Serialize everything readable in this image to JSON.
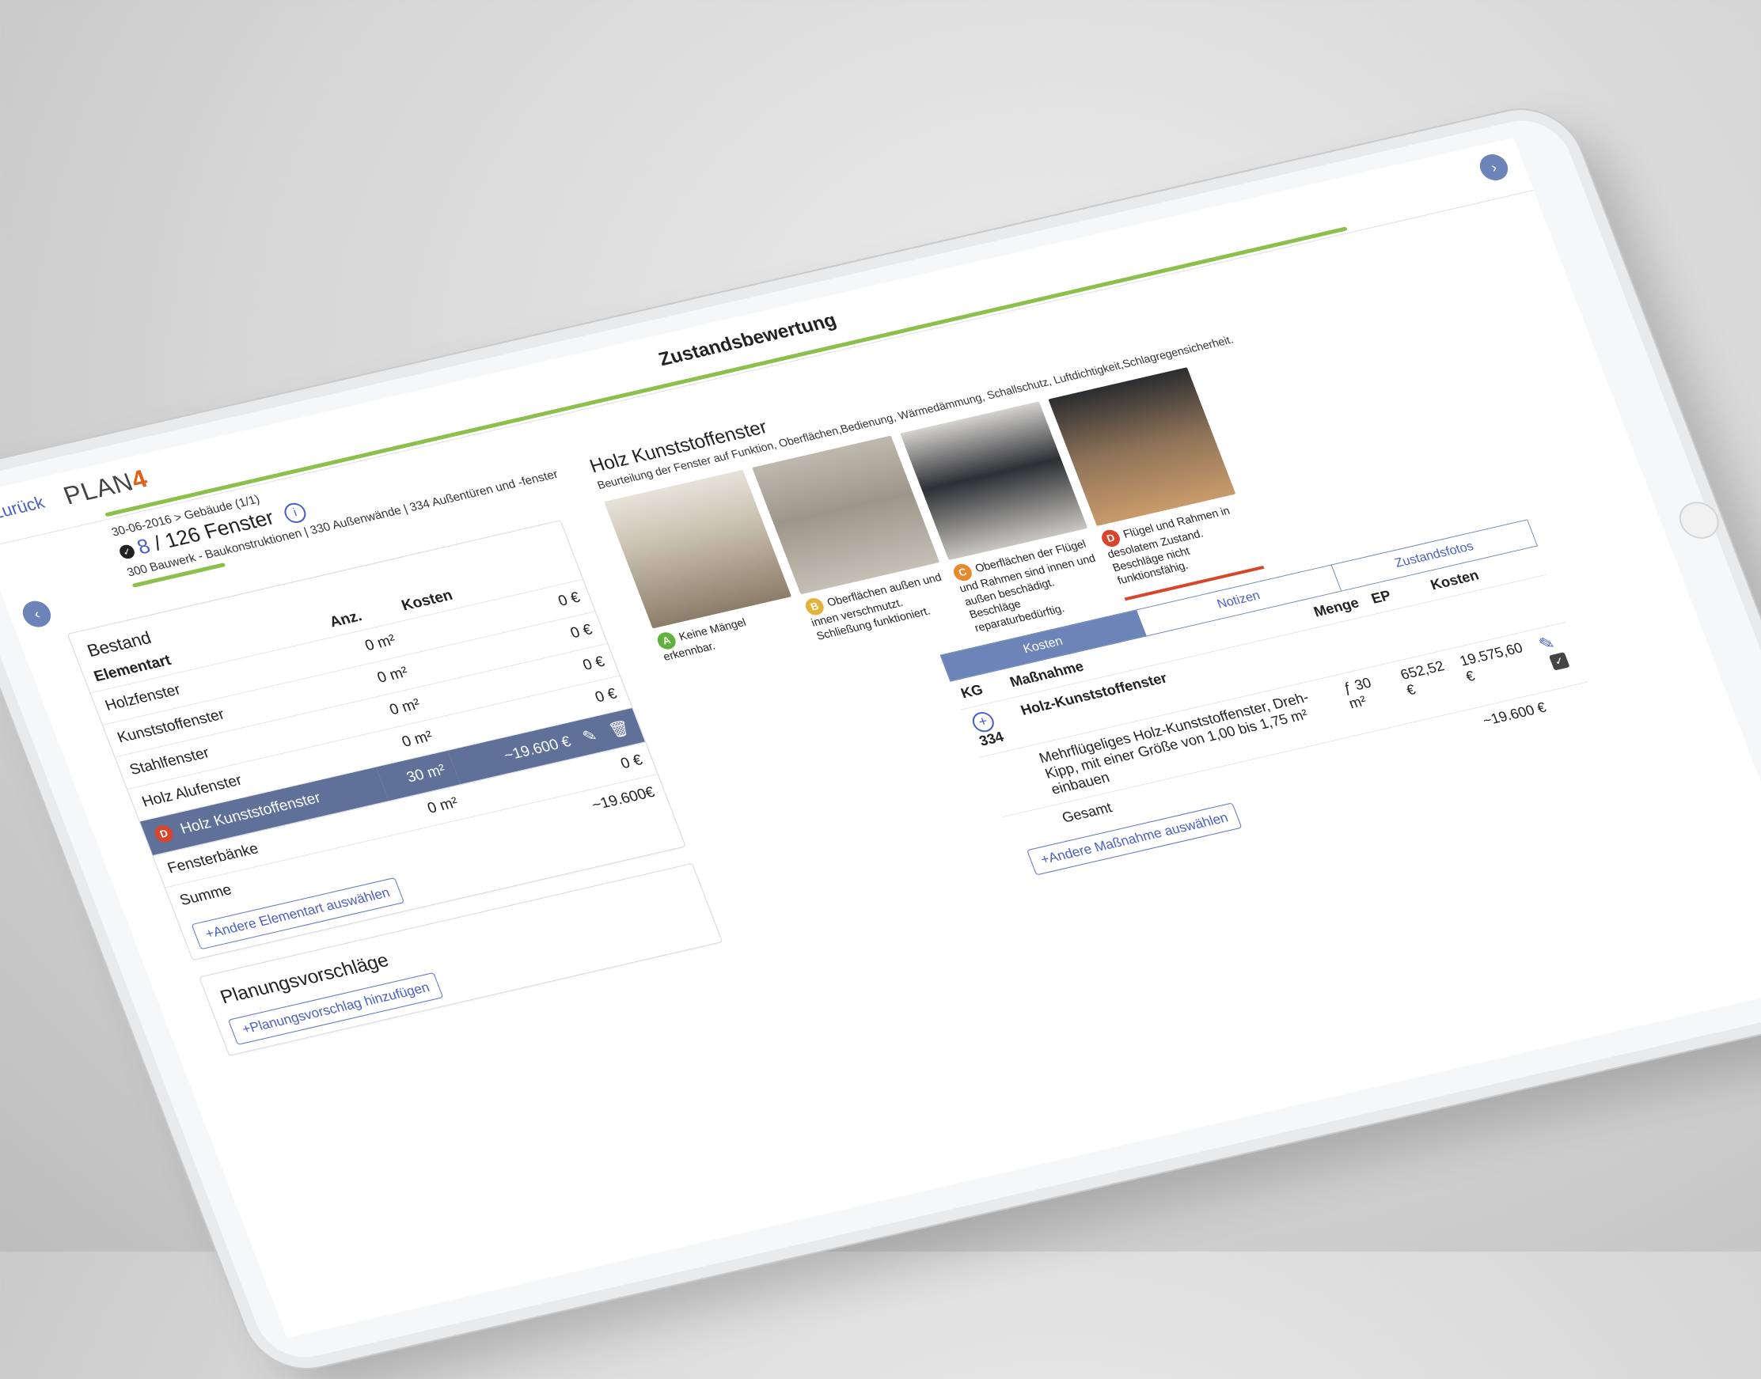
{
  "app": {
    "back_label": "Zurück",
    "logo_text": "PLAN",
    "logo_accent": "4",
    "title": "Zustandsbewertung"
  },
  "header": {
    "date_path": "30-06-2016 > Gebäude (1/1)",
    "current": "8",
    "total_text": "/ 126 Fenster",
    "breadcrumb": "300 Bauwerk - Baukonstruktionen | 330 Außenwände | 334 Außentüren und -fenster"
  },
  "bestand": {
    "title": "Bestand",
    "columns": [
      "Elementart",
      "Anz.",
      "Kosten"
    ],
    "rows": [
      {
        "name": "Holzfenster",
        "anz": "0 m²",
        "kosten": "0 €"
      },
      {
        "name": "Kunststoffenster",
        "anz": "0 m²",
        "kosten": "0 €"
      },
      {
        "name": "Stahlfenster",
        "anz": "0 m²",
        "kosten": "0 €"
      },
      {
        "name": "Holz Alufenster",
        "anz": "0 m²",
        "kosten": "0 €"
      },
      {
        "name": "Holz Kunststoffenster",
        "anz": "30 m²",
        "kosten": "~19.600 €",
        "badge": "D"
      },
      {
        "name": "Fensterbänke",
        "anz": "0 m²",
        "kosten": "0 €"
      }
    ],
    "summe_label": "Summe",
    "summe_value": "~19.600€",
    "add_button": "+Andere Elementart auswählen"
  },
  "planung": {
    "title": "Planungsvorschläge",
    "add_button": "+Planungsvorschlag hinzufügen"
  },
  "detail": {
    "title": "Holz Kunststoffenster",
    "description": "Beurteilung der Fenster auf Funktion, Oberflächen,Bedienung, Wärmedämmung, Schallschutz, Luftdichtigkeit,Schlagregensicherheit.",
    "photos": [
      {
        "badge": "A",
        "caption": "Keine Mängel erkennbar."
      },
      {
        "badge": "B",
        "caption": "Oberflächen außen und innen verschmutzt. Schließung funktioniert."
      },
      {
        "badge": "C",
        "caption": "Oberflächen der Flügel und Rahmen sind innen und außen beschädigt. Beschläge reparaturbedürftig."
      },
      {
        "badge": "D",
        "caption": "Flügel und Rahmen in desolatem Zustand. Beschläge nicht funktionsfähig."
      }
    ],
    "tabs": [
      "Kosten",
      "Notizen",
      "Zustandsfotos"
    ],
    "cost_columns": [
      "KG",
      "Maßnahme",
      "Menge",
      "EP",
      "Kosten"
    ],
    "group_title": "Holz-Kunststoffenster",
    "item_kg": "334",
    "item_text": "Mehrflügeliges Holz-Kunststoffenster, Dreh-Kipp, mit einer Größe von 1,00 bis 1,75 m² einbauen",
    "item_unit": "ƒ",
    "item_menge": "30 m²",
    "item_ep": "652,52 €",
    "item_kosten": "19.575,60 €",
    "gesamt_label": "Gesamt",
    "gesamt_value": "~19.600 €",
    "add_button": "+Andere Maßnahme auswählen"
  },
  "colors": {
    "accent": "#4a5fc1",
    "selected_row": "#5f7099",
    "progress": "#8cc04a",
    "logo_accent": "#e0621a",
    "badge_a": "#5fb23d",
    "badge_b": "#e3b23c",
    "badge_c": "#e58a2d",
    "badge_d": "#d9452b"
  }
}
